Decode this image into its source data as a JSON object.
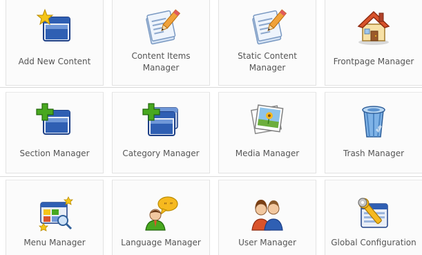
{
  "panel": {
    "tiles": [
      {
        "label": "Add New Content",
        "icon": "add-new-content-icon"
      },
      {
        "label": "Content Items Manager",
        "icon": "content-items-icon"
      },
      {
        "label": "Static Content Manager",
        "icon": "static-content-icon"
      },
      {
        "label": "Frontpage Manager",
        "icon": "frontpage-house-icon"
      },
      {
        "label": "Section Manager",
        "icon": "section-manager-icon"
      },
      {
        "label": "Category Manager",
        "icon": "category-manager-icon"
      },
      {
        "label": "Media Manager",
        "icon": "media-manager-icon"
      },
      {
        "label": "Trash Manager",
        "icon": "trash-can-icon"
      },
      {
        "label": "Menu Manager",
        "icon": "menu-manager-icon"
      },
      {
        "label": "Language Manager",
        "icon": "language-manager-icon"
      },
      {
        "label": "User Manager",
        "icon": "users-icon"
      },
      {
        "label": "Global Configuration",
        "icon": "global-configuration-icon"
      }
    ]
  },
  "colors": {
    "tile_background": "#fbfbfb",
    "tile_border": "#e2e2e2",
    "label_text": "#555555",
    "window_blue": "#2f5fb3",
    "window_frame": "#e9eef7",
    "plus_green": "#48a81f",
    "star_yellow": "#f5c518",
    "house_roof": "#d9532b"
  }
}
